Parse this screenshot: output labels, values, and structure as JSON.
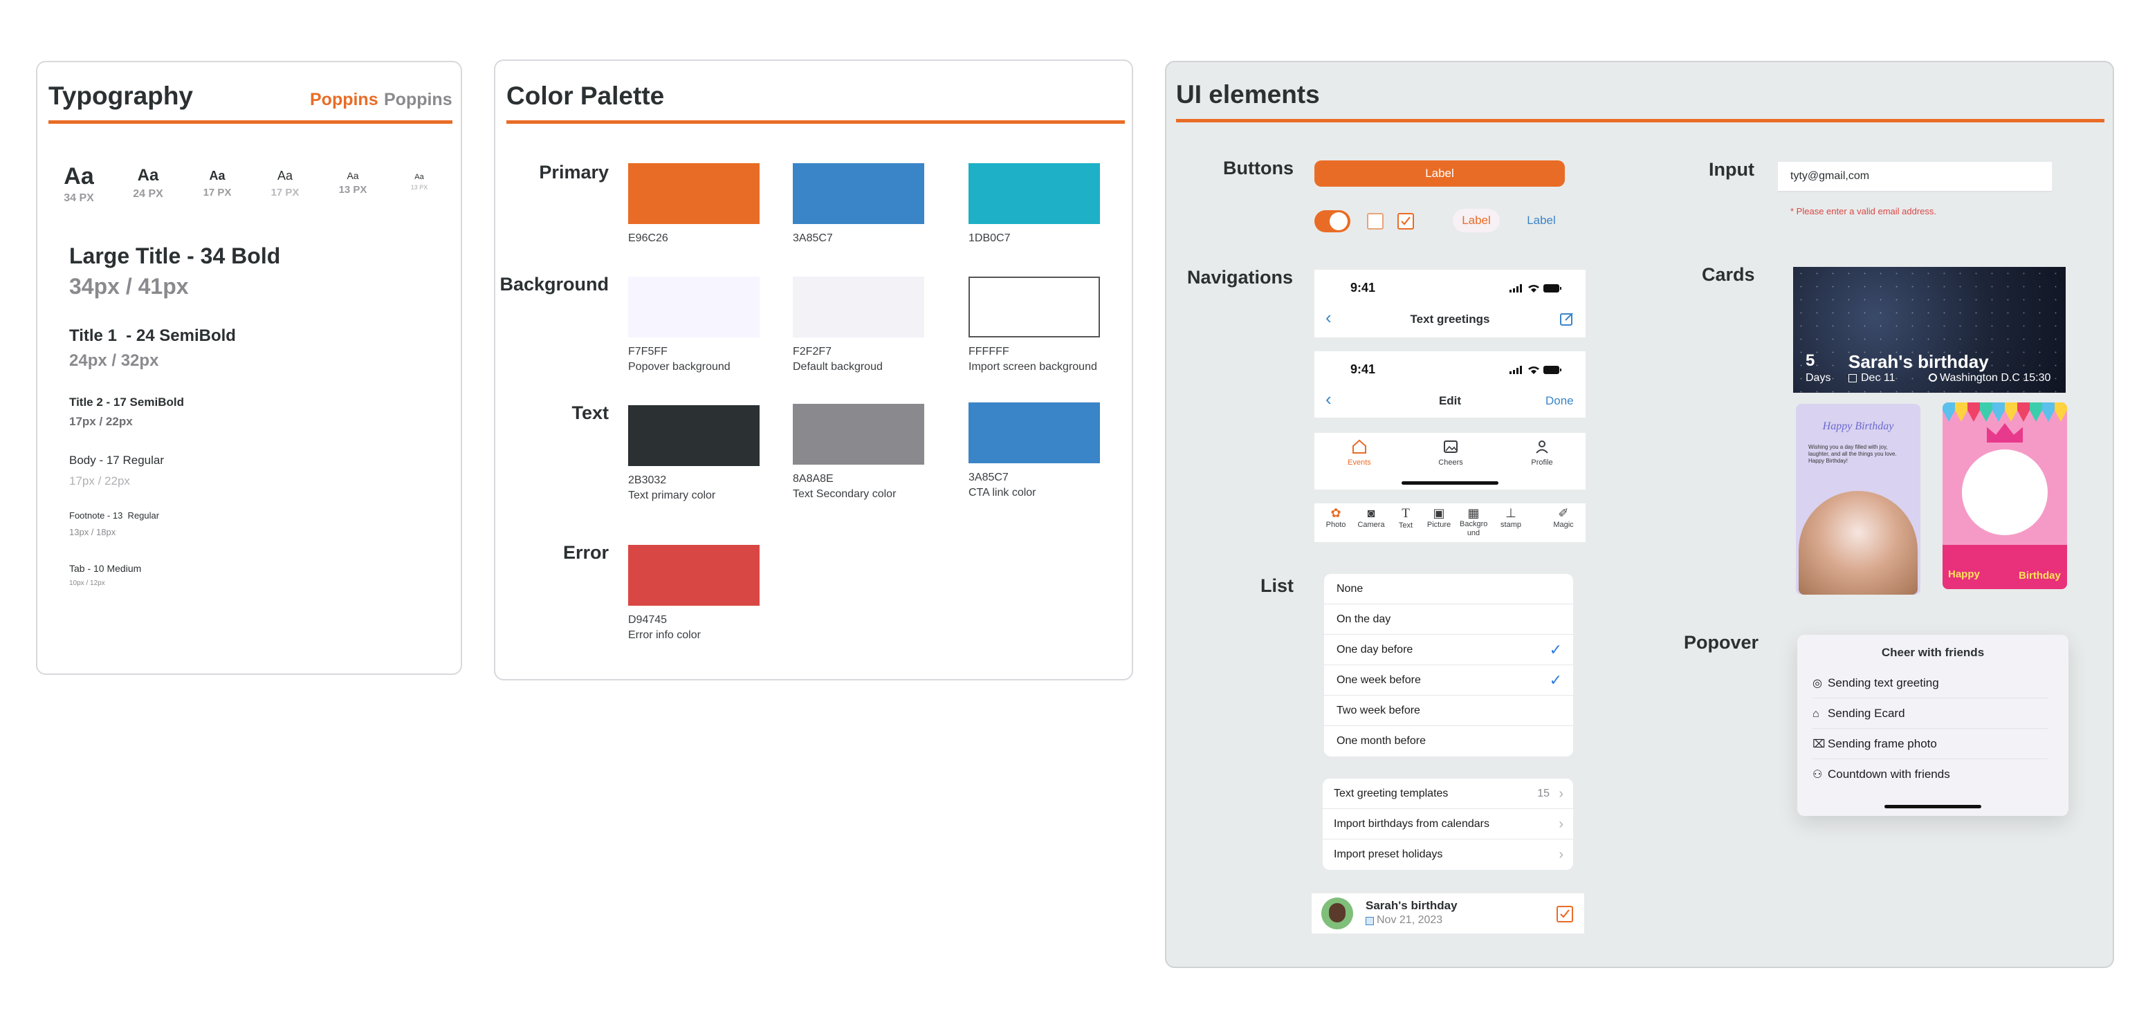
{
  "typography": {
    "title": "Typography",
    "font_primary": "Poppins",
    "font_secondary": "Poppins",
    "scale": [
      {
        "sample": "Aa",
        "label": "34 PX"
      },
      {
        "sample": "Aa",
        "label": "24 PX"
      },
      {
        "sample": "Aa",
        "label": "17 PX"
      },
      {
        "sample": "Aa",
        "label": "17 PX"
      },
      {
        "sample": "Aa",
        "label": "13 PX"
      },
      {
        "sample": "Aa",
        "label": "13 PX"
      }
    ],
    "styles": [
      {
        "name": "Large Title - 34 Bold",
        "spec": "34px / 41px"
      },
      {
        "name": "Title 1  - 24 SemiBold",
        "spec": "24px / 32px"
      },
      {
        "name": "Title 2 - 17 SemiBold",
        "spec": "17px / 22px"
      },
      {
        "name": "Body - 17 Regular",
        "spec": "17px / 22px"
      },
      {
        "name": "Footnote - 13  Regular",
        "spec": "13px / 18px"
      },
      {
        "name": "Tab - 10 Medium",
        "spec": "10px / 12px"
      }
    ]
  },
  "palette": {
    "title": "Color Palette",
    "groups": [
      {
        "label": "Primary",
        "swatches": [
          {
            "hex": "E96C26",
            "desc": "",
            "color": "#E96C26"
          },
          {
            "hex": "3A85C7",
            "desc": "",
            "color": "#3A85C7"
          },
          {
            "hex": "1DB0C7",
            "desc": "",
            "color": "#1DB0C7"
          }
        ]
      },
      {
        "label": "Background",
        "swatches": [
          {
            "hex": "F7F5FF",
            "desc": "Popover background",
            "color": "#F7F5FF"
          },
          {
            "hex": "F2F2F7",
            "desc": "Default backgroud",
            "color": "#F2F2F7"
          },
          {
            "hex": "FFFFFF",
            "desc": "Import screen background",
            "color": "#FFFFFF"
          }
        ]
      },
      {
        "label": "Text",
        "swatches": [
          {
            "hex": "2B3032",
            "desc": "Text primary color",
            "color": "#2B3032"
          },
          {
            "hex": "8A8A8E",
            "desc": "Text Secondary color",
            "color": "#8A8A8E"
          },
          {
            "hex": "3A85C7",
            "desc": "CTA link color",
            "color": "#3A85C7"
          }
        ]
      },
      {
        "label": "Error",
        "swatches": [
          {
            "hex": "D94745",
            "desc": "Error info color",
            "color": "#D94745"
          }
        ]
      }
    ]
  },
  "ui": {
    "title": "UI elements",
    "buttons": {
      "section": "Buttons",
      "primary_label": "Label",
      "tinted_label": "Label",
      "plain_label": "Label"
    },
    "navigations": {
      "section": "Navigations",
      "status_time": "9:41",
      "nav1_title": "Text greetings",
      "nav2_title": "Edit",
      "nav2_done": "Done",
      "tabs": [
        "Events",
        "Cheers",
        "Profile"
      ],
      "toolbar": [
        "Photo",
        "Camera",
        "Text",
        "Picture",
        "Backgro und",
        "stamp",
        "Magic"
      ]
    },
    "list": {
      "section": "List",
      "options": [
        {
          "label": "None",
          "checked": false
        },
        {
          "label": "On the day",
          "checked": false
        },
        {
          "label": "One day before",
          "checked": true
        },
        {
          "label": "One week before",
          "checked": true
        },
        {
          "label": "Two week before",
          "checked": false
        },
        {
          "label": "One month before",
          "checked": false
        }
      ],
      "links": [
        {
          "label": "Text greeting templates",
          "count": "15"
        },
        {
          "label": "Import birthdays from calendars",
          "count": ""
        },
        {
          "label": "Import preset holidays",
          "count": ""
        }
      ],
      "contact_name": "Sarah's birthday",
      "contact_date": "Nov 21, 2023"
    },
    "input": {
      "section": "Input",
      "value": "tyty@gmail,com",
      "error": "* Please enter a valid email address."
    },
    "cards": {
      "section": "Cards",
      "days_num": "5",
      "days_label": "Days",
      "name": "Sarah's birthday",
      "date": "Dec 11",
      "location": "Washington D.C 15:30",
      "card1_title": "Happy Birthday",
      "card1_text": "Wishing you a day filled with joy, laughter, and all the things you love. Happy Birthday!",
      "card2_word1": "Happy",
      "card2_word2": "Birthday"
    },
    "popover": {
      "section": "Popover",
      "title": "Cheer with friends",
      "items": [
        "Sending text greeting",
        "Sending Ecard",
        "Sending frame photo",
        "Countdown with friends"
      ]
    },
    "colors": {
      "accent": "#E96C26",
      "link": "#3A85C7",
      "panel_bg": "#E8EBEB"
    }
  }
}
